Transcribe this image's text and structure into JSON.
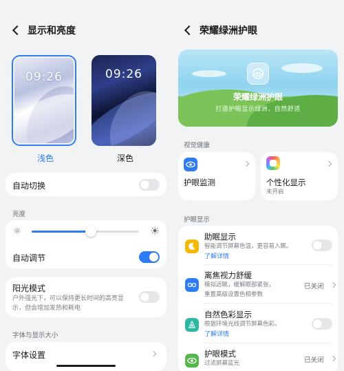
{
  "left": {
    "title": "显示和亮度",
    "themes": {
      "light": {
        "time": "09:26",
        "label": "浅色"
      },
      "dark": {
        "time": "09:26",
        "label": "深色"
      }
    },
    "auto_switch": {
      "label": "自动切换",
      "on": false
    },
    "brightness": {
      "section": "亮度",
      "level": 0.55,
      "auto_label": "自动调节",
      "auto_on": true
    },
    "sunlight": {
      "label": "阳光模式",
      "desc_line1": "户外强光下，可以保持更长时间的高亮显",
      "desc_line2": "示，但会增加发热和耗电",
      "on": false
    },
    "font_section": "字体与显示大小",
    "font_settings": "字体设置"
  },
  "right": {
    "title": "荣耀绿洲护眼",
    "banner": {
      "title": "荣耀绿洲护眼",
      "subtitle": "打造护眼显示绿洲，自然舒适"
    },
    "visual_health": {
      "section": "视觉健康",
      "monitor_label": "护眼监测",
      "personal_label": "个性化显示",
      "personal_status": "未开启"
    },
    "eye_display": {
      "section": "护眼显示",
      "items": [
        {
          "title": "助眠显示",
          "desc": "智能调节屏幕色温，更容易入眠。",
          "link": "了解详情",
          "color": "#f5b800"
        },
        {
          "title": "离焦视力舒缓",
          "desc1": "模拟远眺，缓解眼部紧张，",
          "desc2": "重置高级设置色相参数",
          "status": "已关闭",
          "color": "#2e7bf6"
        },
        {
          "title": "自然色彩显示",
          "desc": "根据环境光线调节屏幕色彩。",
          "link": "了解详情",
          "color": "#2bb8a4"
        },
        {
          "title": "护眼模式",
          "desc": "过滤屏幕蓝光",
          "status": "已关闭",
          "color": "#56b84a"
        }
      ]
    }
  }
}
